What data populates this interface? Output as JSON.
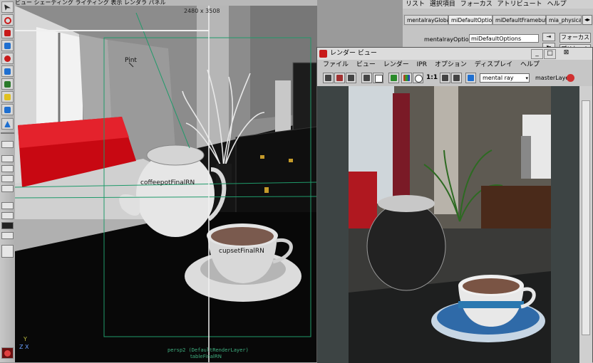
{
  "viewport": {
    "menu_text": "ビュー シェーディング ライティング 表示 レンダラ パネル",
    "resolution": "2480 x 3508",
    "locator_label": "Pint",
    "teapot_label": "coffeepotFinalRN",
    "cup_label": "cupsetFinalRN",
    "camera_label": "persp2 (DefaultRenderLayer)",
    "bottom_label": "tableFinalRN",
    "axis_y": "Y",
    "axis_zx": "Z X"
  },
  "attribute_editor": {
    "menu": [
      "リスト",
      "選択項目",
      "フォーカス",
      "アトリビュート",
      "ヘルプ"
    ],
    "tabs": [
      "mentalrayGlobals",
      "miDefaultOptions",
      "miDefaultFramebuffer",
      "mia_physicalsky"
    ],
    "active_tab": "miDefaultOptions",
    "options_label": "mentalrayOptions:",
    "options_value": "miDefaultOptions",
    "focus_button": "フォーカス",
    "preset_button": "プリセット"
  },
  "render_view": {
    "title": "レンダー ビュー",
    "menu": [
      "ファイル",
      "ビュー",
      "レンダー",
      "IPR",
      "オプション",
      "ディスプレイ",
      "ヘルプ"
    ],
    "ratio_label": "1:1",
    "renderer": "mental ray",
    "layer": "masterLayer",
    "window_controls": [
      "_",
      "□",
      "⊠"
    ]
  },
  "colors": {
    "pillow_red": "#c80812",
    "render_bg": "#3d4444",
    "viewport_bg": "#141414",
    "toolbar_red": "#c81a1a",
    "toolbar_blue": "#1f6fd0"
  }
}
